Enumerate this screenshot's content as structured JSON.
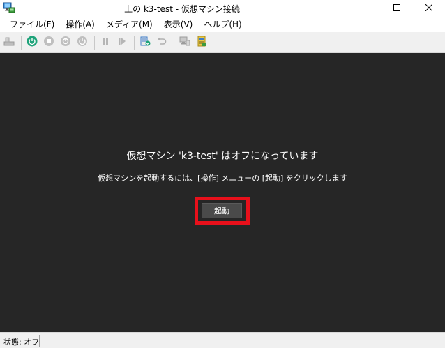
{
  "window": {
    "title": "上の k3-test - 仮想マシン接続",
    "app_icon": "vm-connection-icon",
    "controls": [
      "minimize-icon",
      "maximize-icon",
      "close-icon"
    ]
  },
  "menubar": {
    "items": [
      {
        "label": "ファイル(F)"
      },
      {
        "label": "操作(A)"
      },
      {
        "label": "メディア(M)"
      },
      {
        "label": "表示(V)"
      },
      {
        "label": "ヘルプ(H)"
      }
    ]
  },
  "toolbar": {
    "buttons": [
      "ctrl-alt-del-icon",
      "start-power-icon",
      "turn-off-icon",
      "shut-down-icon",
      "save-state-icon",
      "pause-icon",
      "reset-icon",
      "checkpoint-icon",
      "revert-icon",
      "enhanced-session-icon",
      "share-icon"
    ],
    "accent_color": "#1fa37a"
  },
  "display": {
    "background": "#262626",
    "message_title": "仮想マシン 'k3-test' はオフになっています",
    "message_subtitle": "仮想マシンを起動するには、[操作] メニューの [起動] をクリックします",
    "start_button_label": "起動",
    "highlight_color": "#e8101b"
  },
  "statusbar": {
    "status": "状態: オフ"
  }
}
